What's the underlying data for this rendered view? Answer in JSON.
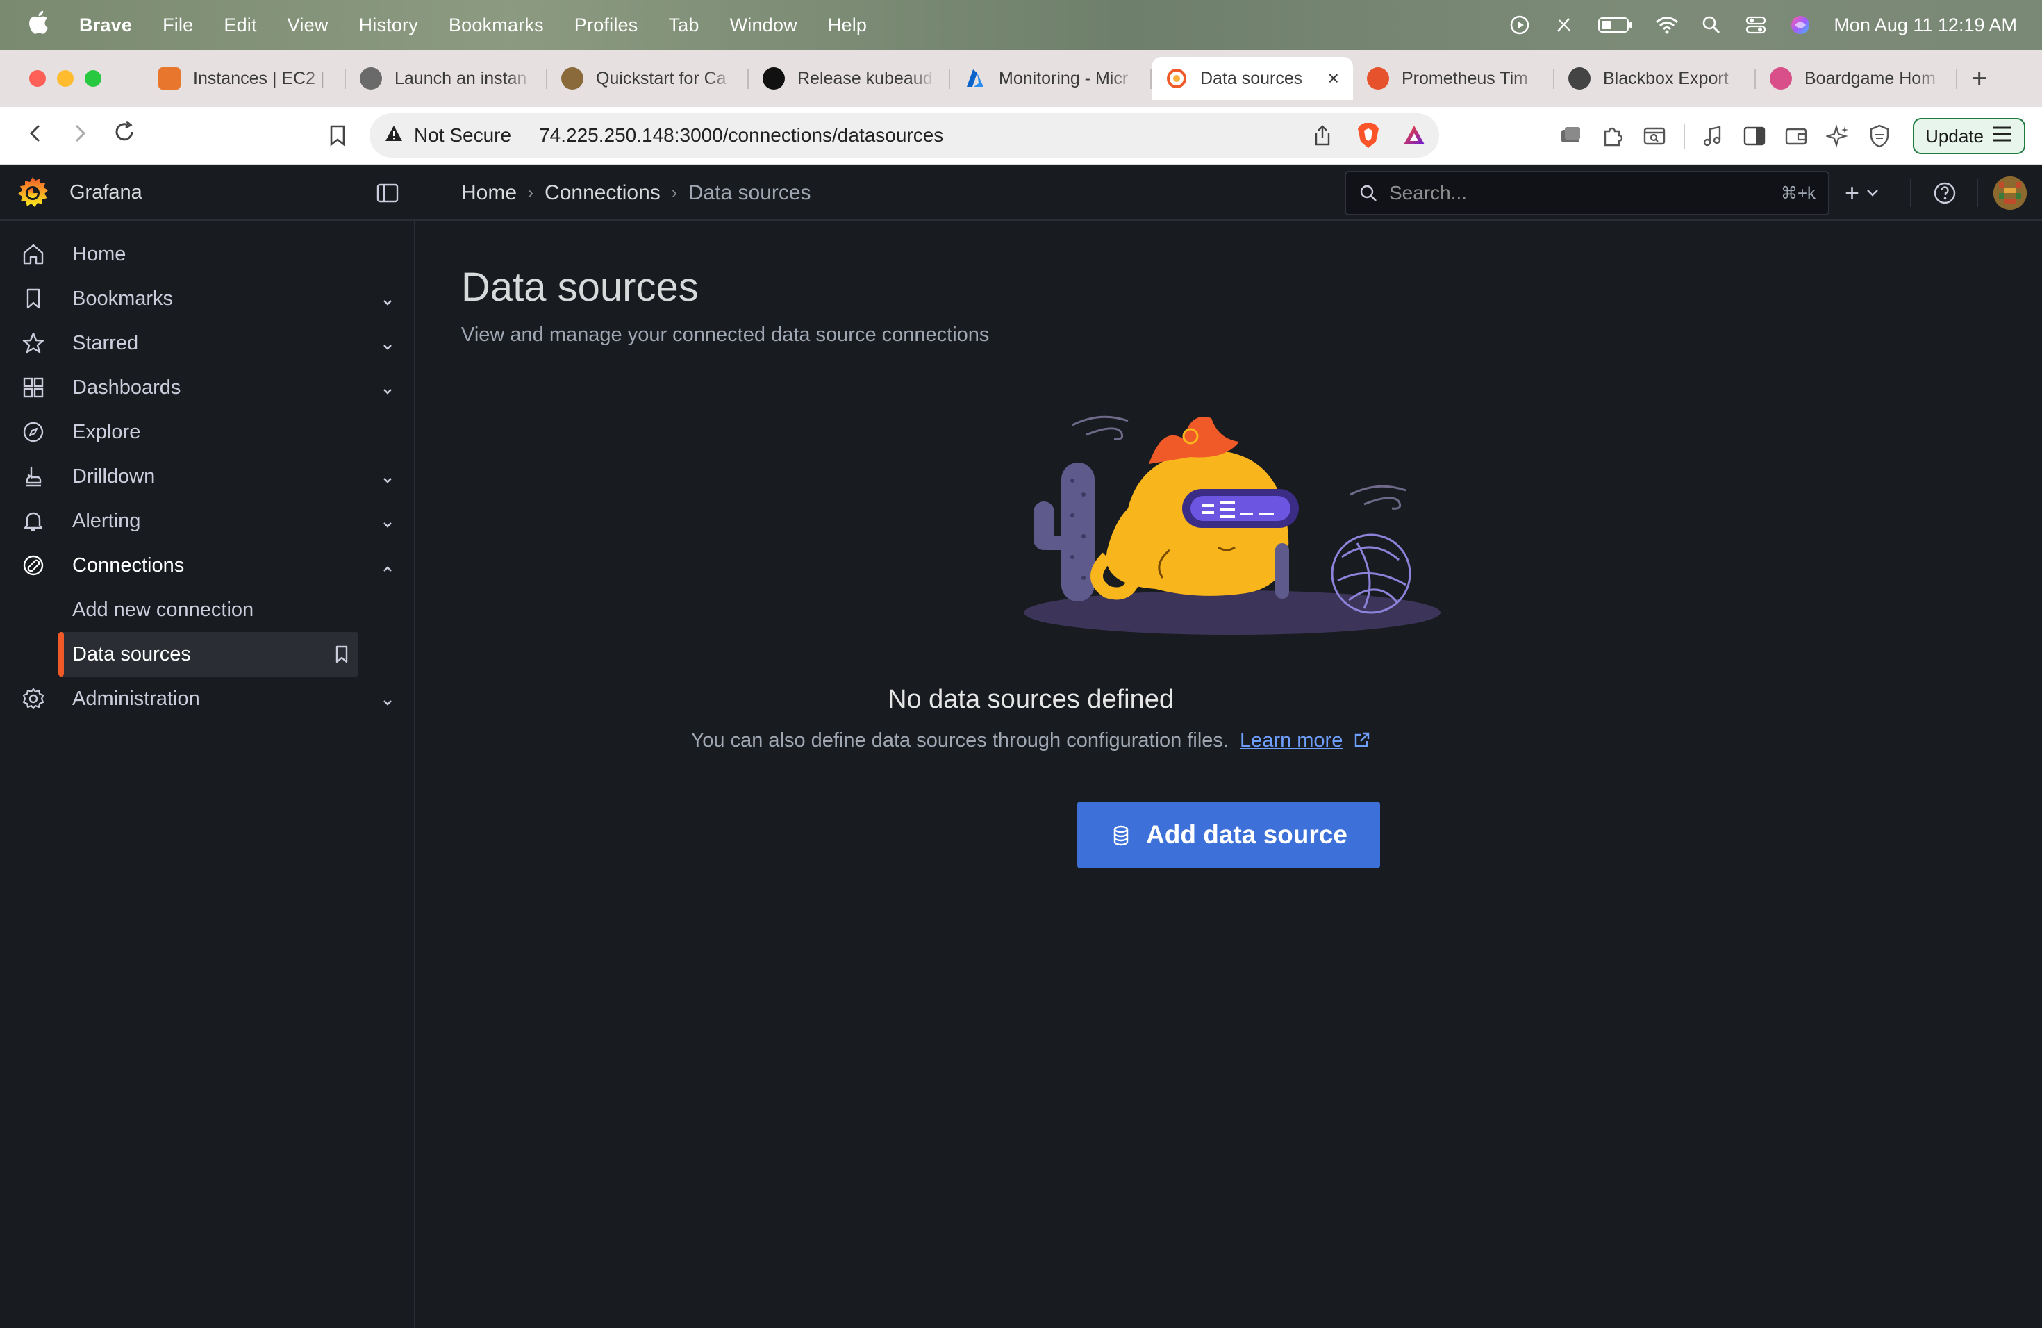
{
  "menubar": {
    "app": "Brave",
    "menus": [
      "File",
      "Edit",
      "View",
      "History",
      "Bookmarks",
      "Profiles",
      "Tab",
      "Window",
      "Help"
    ],
    "clock": "Mon Aug 11  12:19 AM"
  },
  "tabs": [
    {
      "label": "Instances | EC2 |",
      "color": "#e8762c"
    },
    {
      "label": "Launch an instan",
      "color": "#555555"
    },
    {
      "label": "Quickstart for Ca",
      "color": "#8a6a3a"
    },
    {
      "label": "Release kubeaud",
      "color": "#111111"
    },
    {
      "label": "Monitoring - Micr",
      "color": "#1a6fd1"
    },
    {
      "label": "Data sources",
      "color": "#f05a28",
      "active": true
    },
    {
      "label": "Prometheus Tim",
      "color": "#e6522c"
    },
    {
      "label": "Blackbox Export",
      "color": "#444444"
    },
    {
      "label": "Boardgame Hom",
      "color": "#d94f8a"
    }
  ],
  "tab_close": "×",
  "new_tab": "+",
  "address": {
    "security": "Not Secure",
    "url": "74.225.250.148:3000/connections/datasources",
    "update_label": "Update"
  },
  "grafana": {
    "brand": "Grafana",
    "breadcrumb": [
      "Home",
      "Connections",
      "Data sources"
    ],
    "search_placeholder": "Search...",
    "search_shortcut": "⌘+k",
    "plus": "+"
  },
  "sidebar": {
    "items": [
      {
        "label": "Home",
        "icon": "home-icon"
      },
      {
        "label": "Bookmarks",
        "icon": "bookmark-icon"
      },
      {
        "label": "Starred",
        "icon": "star-icon"
      },
      {
        "label": "Dashboards",
        "icon": "dashboards-icon"
      },
      {
        "label": "Explore",
        "icon": "compass-icon"
      },
      {
        "label": "Drilldown",
        "icon": "drilldown-icon"
      },
      {
        "label": "Alerting",
        "icon": "bell-icon"
      },
      {
        "label": "Connections",
        "icon": "connections-icon"
      },
      {
        "label": "Administration",
        "icon": "gear-icon"
      }
    ],
    "sub_items": [
      {
        "label": "Add new connection"
      },
      {
        "label": "Data sources",
        "active": true
      }
    ]
  },
  "main": {
    "title": "Data sources",
    "subtitle": "View and manage your connected data source connections",
    "empty_title": "No data sources defined",
    "empty_desc": "You can also define data sources through configuration files.",
    "learn_more": "Learn more",
    "add_button": "Add data source"
  },
  "colors": {
    "accent": "#f05a28",
    "primary_button": "#3d71d9",
    "link": "#6e9fff",
    "background": "#181b1f"
  }
}
